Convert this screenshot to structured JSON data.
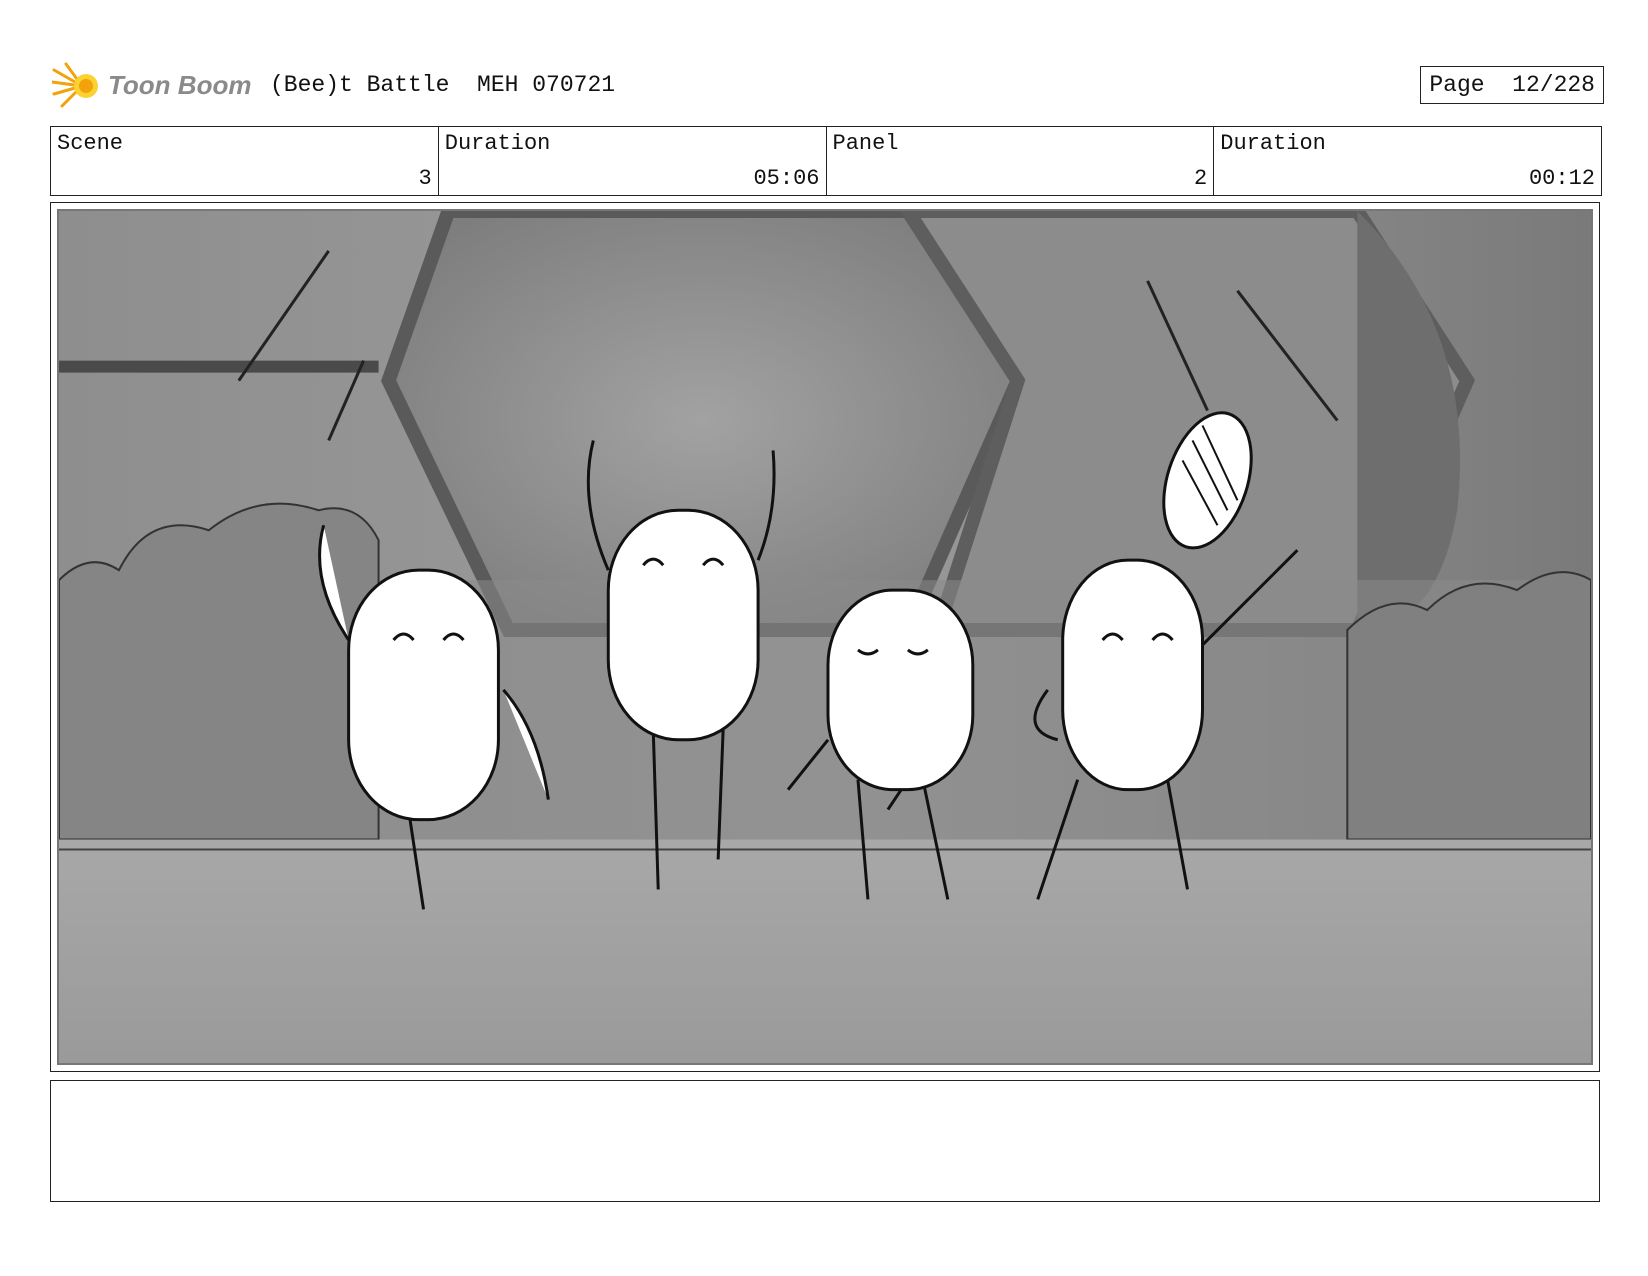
{
  "header": {
    "logo_text": "Toon Boom",
    "project_title": "(Bee)t Battle  MEH 070721",
    "page_label": "Page",
    "page_value": "12/228"
  },
  "info": [
    {
      "label": "Scene",
      "value": "3"
    },
    {
      "label": "Duration",
      "value": "05:06"
    },
    {
      "label": "Panel",
      "value": "2"
    },
    {
      "label": "Duration",
      "value": "00:12"
    }
  ],
  "notes": {
    "text": ""
  },
  "colors": {
    "logo_orange": "#f2a20a",
    "logo_yellow": "#fbd232",
    "frame_border": "#222222"
  },
  "icons": {
    "logo": "toon-boom-sun-icon"
  }
}
